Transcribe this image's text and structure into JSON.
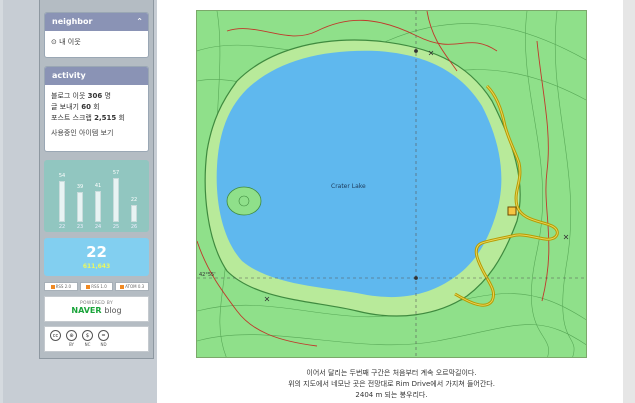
{
  "sidebar": {
    "neighbor": {
      "title": "neighbor",
      "toggle": "⌃",
      "item": "내 이웃"
    },
    "activity": {
      "title": "activity",
      "stats": [
        {
          "label": "블로그 이웃",
          "value": "306",
          "unit": "명"
        },
        {
          "label": "글 보내기",
          "value": "60",
          "unit": "회"
        },
        {
          "label": "포스트 스크랩",
          "value": "2,515",
          "unit": "회"
        }
      ],
      "items_link": "사용중인 아이템 보기"
    },
    "visitor_graph": {
      "bars": [
        {
          "value": 54,
          "day": "22"
        },
        {
          "value": 39,
          "day": "23"
        },
        {
          "value": 41,
          "day": "24"
        },
        {
          "value": 57,
          "day": "25"
        },
        {
          "value": 22,
          "day": "26"
        }
      ]
    },
    "today": {
      "count": "22",
      "total": "611,643"
    },
    "rss": [
      "RSS 2.0",
      "RSS 1.0",
      "ATOM 0.3"
    ],
    "powered": {
      "line": "POWERED BY",
      "naver": "NAVER",
      "blog": "blog"
    },
    "cc": [
      {
        "icon": "cc",
        "label": ""
      },
      {
        "icon": "by",
        "label": "BY"
      },
      {
        "icon": "nc",
        "label": "NC"
      },
      {
        "icon": "nd",
        "label": "ND"
      }
    ]
  },
  "map": {
    "lake_label": "Crater Lake",
    "lat_label": "42°55'",
    "colors": {
      "land": "#8fe08a",
      "water": "#5fb8ee",
      "route": "#b89a00",
      "contour": "#4a9a4a",
      "road": "#c0392b"
    }
  },
  "caption": {
    "line1": "이어서 달리는 두번째 구간은 처음부터 계속 오르막길이다.",
    "line2": "위의 지도에서 네모난 곳은 전망대로 Rim Drive에서 가지쳐 들어간다.",
    "line3": "2404 m 되는 봉우리다."
  }
}
